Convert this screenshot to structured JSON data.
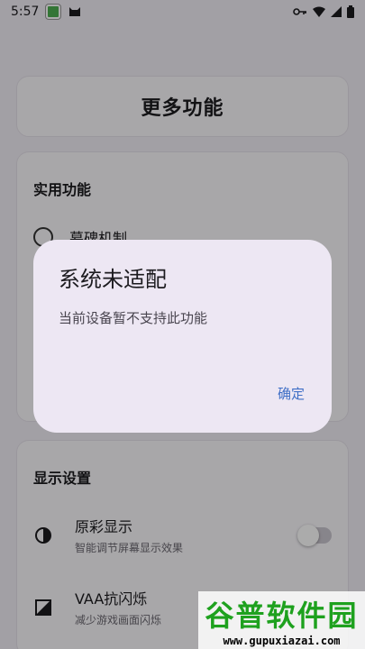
{
  "status_bar": {
    "time": "5:57"
  },
  "header": {
    "title": "更多功能"
  },
  "utility_section": {
    "title": "实用功能",
    "partial_item": "幕碑机制"
  },
  "display_section": {
    "title": "显示设置",
    "items": [
      {
        "title": "原彩显示",
        "subtitle": "智能调节屏幕显示效果",
        "icon": "contrast-icon"
      },
      {
        "title": "VAA抗闪烁",
        "subtitle": "减少游戏画面闪烁",
        "icon": "flicker-icon"
      }
    ]
  },
  "dialog": {
    "title": "系统未适配",
    "message": "当前设备暂不支持此功能",
    "confirm_label": "确定"
  },
  "watermark": {
    "brand": "谷普软件园",
    "url": "www.gupuxiazai.com"
  },
  "colors": {
    "accent": "#3f6fc6",
    "watermark_green": "#1ea11e"
  }
}
